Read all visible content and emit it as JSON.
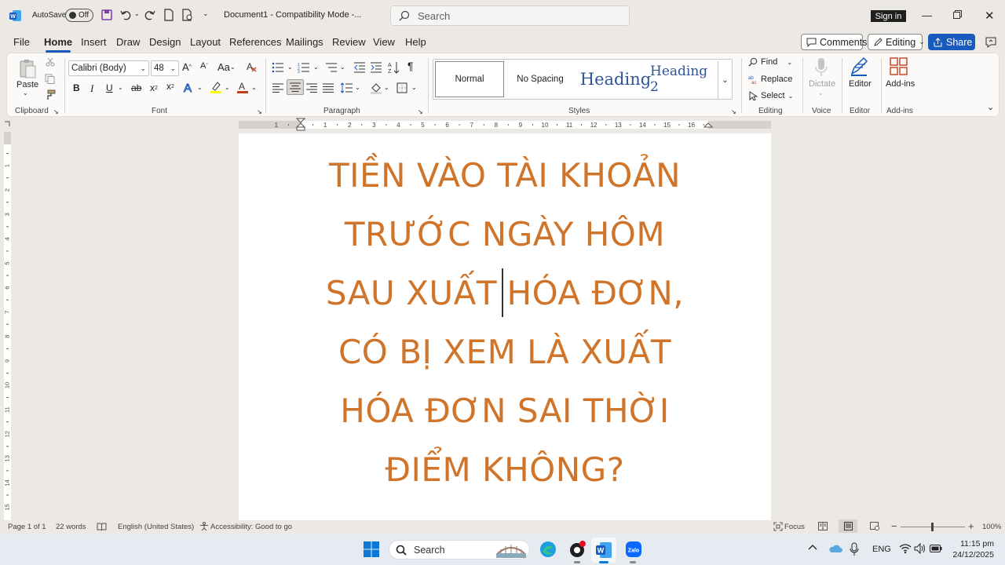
{
  "titlebar": {
    "autosave_label": "AutoSave",
    "autosave_state": "Off",
    "doc_title": "Document1  -  Compatibility Mode  -...",
    "search_placeholder": "Search",
    "signin_label": "Sign in"
  },
  "tabs": [
    "File",
    "Home",
    "Insert",
    "Draw",
    "Design",
    "Layout",
    "References",
    "Mailings",
    "Review",
    "View",
    "Help"
  ],
  "active_tab": "Home",
  "right_buttons": {
    "comments": "Comments",
    "editing": "Editing",
    "share": "Share"
  },
  "ribbon": {
    "clipboard": {
      "paste": "Paste",
      "label": "Clipboard"
    },
    "font": {
      "name": "Calibri (Body)",
      "size": "48",
      "label": "Font"
    },
    "paragraph": {
      "label": "Paragraph"
    },
    "styles": {
      "items": [
        "Normal",
        "No Spacing",
        "Heading",
        "Heading 2"
      ],
      "label": "Styles"
    },
    "editing": {
      "find": "Find",
      "replace": "Replace",
      "select": "Select",
      "label": "Editing"
    },
    "voice": {
      "dictate": "Dictate",
      "label": "Voice"
    },
    "editor": {
      "editor": "Editor",
      "label": "Editor"
    },
    "addins": {
      "addins": "Add-ins",
      "label": "Add-ins"
    }
  },
  "ruler": {
    "numbers": [
      "1",
      "1",
      "2",
      "3",
      "4",
      "5",
      "6",
      "7",
      "8",
      "9",
      "10",
      "11",
      "12",
      "13",
      "14",
      "15",
      "16"
    ],
    "vnumbers": [
      "1",
      "2",
      "3",
      "4",
      "5",
      "6",
      "7",
      "8",
      "9",
      "10",
      "11",
      "12",
      "13",
      "14",
      "15"
    ]
  },
  "document": {
    "lines": [
      "TIỀN VÀO TÀI KHOẢN",
      "TRƯỚC NGÀY HÔM",
      "SAU XUẤT",
      "HÓA ĐƠN,",
      "CÓ BỊ XEM LÀ XUẤT",
      "HÓA ĐƠN SAI THỜI",
      "ĐIỂM KHÔNG?"
    ],
    "text_color": "#d0742a"
  },
  "statusbar": {
    "page": "Page 1 of 1",
    "words": "22 words",
    "language": "English (United States)",
    "accessibility": "Accessibility: Good to go",
    "focus": "Focus",
    "zoom": "100%"
  },
  "taskbar": {
    "search": "Search",
    "lang": "ENG",
    "time": "11:15 pm",
    "date": "24/12/2025"
  }
}
